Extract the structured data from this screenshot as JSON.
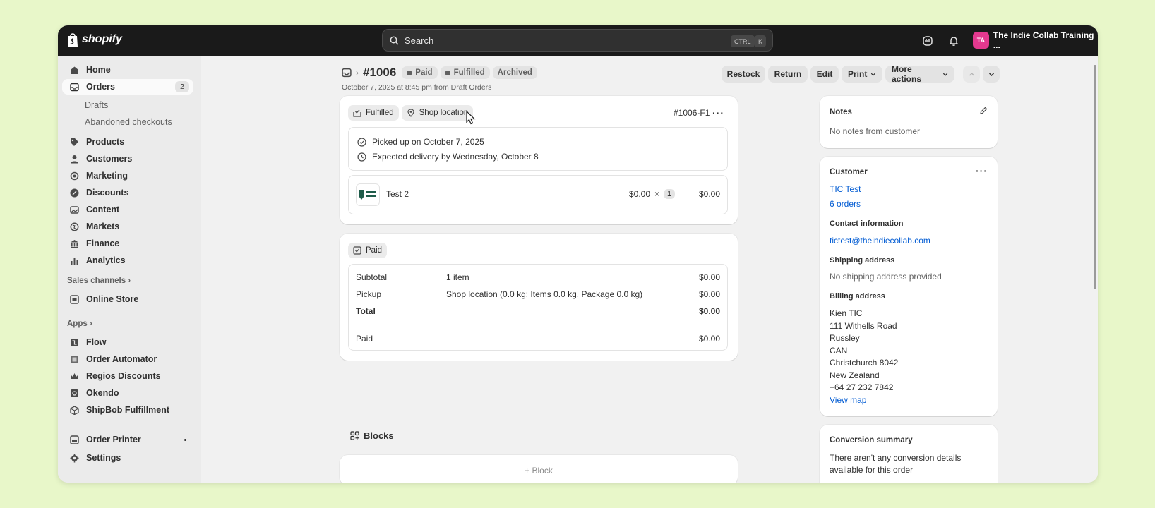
{
  "topbar": {
    "brand": "shopify",
    "search_label": "Search",
    "kbd1": "CTRL",
    "kbd2": "K",
    "avatar_initials": "TA",
    "store_name": "The Indie Collab Training ..."
  },
  "sidebar": {
    "home": "Home",
    "orders": "Orders",
    "orders_count": "2",
    "drafts": "Drafts",
    "abandoned": "Abandoned checkouts",
    "products": "Products",
    "customers": "Customers",
    "marketing": "Marketing",
    "discounts": "Discounts",
    "content": "Content",
    "markets": "Markets",
    "finance": "Finance",
    "analytics": "Analytics",
    "sales_channels": "Sales channels ›",
    "online_store": "Online Store",
    "apps": "Apps ›",
    "flow": "Flow",
    "order_automator": "Order Automator",
    "regios": "Regios Discounts",
    "okendo": "Okendo",
    "shipbob": "ShipBob Fulfillment",
    "order_printer": "Order Printer",
    "settings": "Settings"
  },
  "header": {
    "order_number": "#1006",
    "status_paid": "Paid",
    "status_fulfilled": "Fulfilled",
    "status_archived": "Archived",
    "subtitle": "October 7, 2025 at 8:45 pm from Draft Orders",
    "restock": "Restock",
    "return": "Return",
    "edit": "Edit",
    "print": "Print",
    "more_actions": "More actions"
  },
  "fulfillment": {
    "status": "Fulfilled",
    "location": "Shop location",
    "id": "#1006-F1",
    "picked_up": "Picked up on October 7, 2025",
    "expected": "Expected delivery by Wednesday, October 8",
    "item_name": "Test 2",
    "item_price": "$0.00",
    "times": "×",
    "item_qty": "1",
    "item_total": "$0.00"
  },
  "payment": {
    "status": "Paid",
    "subtotal_label": "Subtotal",
    "subtotal_desc": "1 item",
    "subtotal_value": "$0.00",
    "pickup_label": "Pickup",
    "pickup_desc": "Shop location (0.0 kg: Items 0.0 kg, Package 0.0 kg)",
    "pickup_value": "$0.00",
    "total_label": "Total",
    "total_value": "$0.00",
    "paid_label": "Paid",
    "paid_value": "$0.00"
  },
  "blocks": {
    "title": "Blocks",
    "add_block": "+ Block"
  },
  "notes": {
    "title": "Notes",
    "text": "No notes from customer"
  },
  "customer": {
    "title": "Customer",
    "name": "TIC Test",
    "orders": "6 orders",
    "contact_title": "Contact information",
    "email": "tictest@theindiecollab.com",
    "shipping_title": "Shipping address",
    "shipping_text": "No shipping address provided",
    "billing_title": "Billing address",
    "billing_lines": [
      "Kien TIC",
      "111 Withells Road",
      "Russley",
      "CAN",
      "Christchurch 8042",
      "New Zealand",
      "+64 27 232 7842"
    ],
    "view_map": "View map"
  },
  "conversion": {
    "title": "Conversion summary",
    "text": "There aren't any conversion details available for this order"
  }
}
